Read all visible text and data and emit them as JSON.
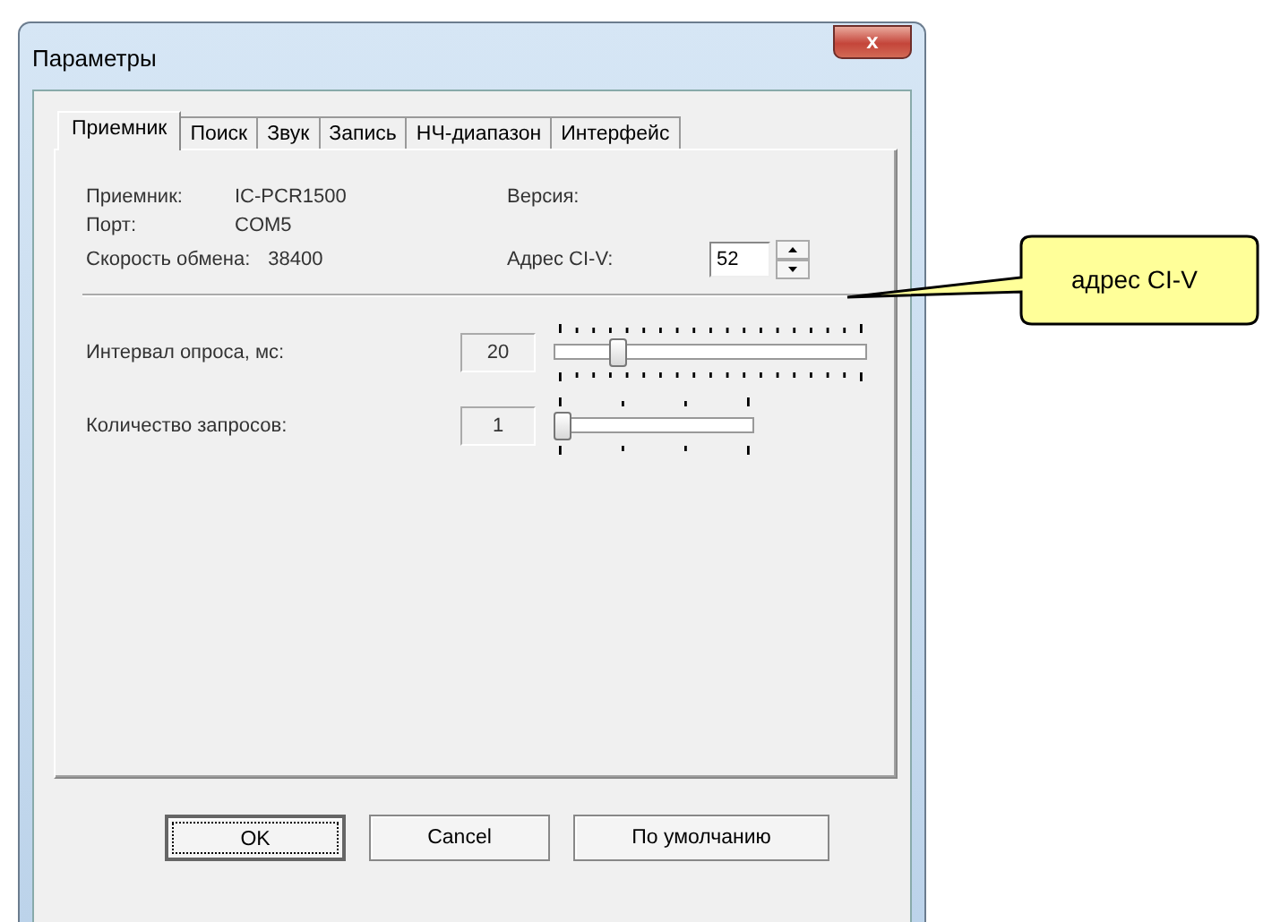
{
  "window": {
    "title": "Параметры",
    "close": "x"
  },
  "tabs": [
    {
      "label": "Приемник",
      "selected": true
    },
    {
      "label": "Поиск",
      "selected": false
    },
    {
      "label": "Звук",
      "selected": false
    },
    {
      "label": "Запись",
      "selected": false
    },
    {
      "label": "НЧ-диапазон",
      "selected": false
    },
    {
      "label": "Интерфейс",
      "selected": false
    }
  ],
  "info": {
    "receiver_label": "Приемник:",
    "receiver": "IC-PCR1500",
    "version_label": "Версия:",
    "port_label": "Порт:",
    "port": "COM5",
    "speed_label": "Скорость обмена:",
    "speed": "38400",
    "address_label": "Адрес CI-V:",
    "address": "52"
  },
  "sliders": [
    {
      "label": "Интервал опроса, мс:",
      "reading": "20",
      "level": 0.19
    },
    {
      "label": "Количество запросов:",
      "reading": "1",
      "level": 0
    }
  ],
  "buttons": [
    {
      "label": "OK",
      "focused": true
    },
    {
      "label": "Cancel",
      "focused": false
    },
    {
      "label": "По умолчанию",
      "focused": false
    }
  ],
  "callout": {
    "text": "адрес CI-V"
  }
}
